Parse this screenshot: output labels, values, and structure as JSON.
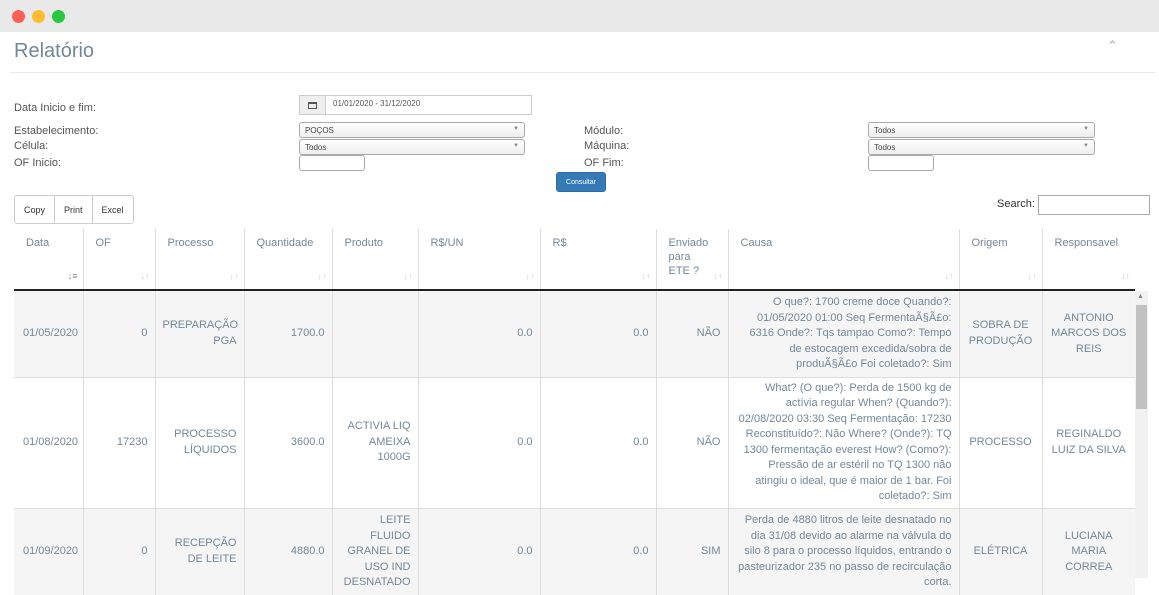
{
  "panel": {
    "title": "Relatório",
    "collapse_icon": "chevron-up-icon"
  },
  "filters": {
    "date_label": "Data Inicio e fim:",
    "date_value": "01/01/2020 - 31/12/2020",
    "estabelecimento_label": "Estabelecimento:",
    "estabelecimento_value": "POÇOS",
    "celula_label": "Célula:",
    "celula_value": "Todos",
    "of_inicio_label": "OF Inicio:",
    "modulo_label": "Módulo:",
    "modulo_value": "Todos",
    "maquina_label": "Máquina:",
    "maquina_value": "Todos",
    "of_fim_label": "OF Fim:",
    "consultar_label": "Consultar"
  },
  "toolbar": {
    "copy": "Copy",
    "print": "Print",
    "excel": "Excel",
    "search_label": "Search:"
  },
  "table": {
    "headers": [
      "Data",
      "OF",
      "Processo",
      "Quantidade",
      "Produto",
      "R$/UN",
      "R$",
      "Enviado para ETE ?",
      "Causa",
      "Origem",
      "Responsavel"
    ],
    "rows": [
      {
        "data": "01/05/2020",
        "of": "0",
        "processo": "PREPARAÇÃO PGA",
        "quantidade": "1700.0",
        "produto": "",
        "rsun": "0.0",
        "rs": "0.0",
        "ete": "NÃO",
        "causa": "O que?: 1700 creme doce Quando?: 01/05/2020 01:00 Seq FermentaÃ§Ã£o: 6316 Onde?: Tqs tampao Como?: Tempo de estocagem excedida/sobra de produÃ§Ã£o Foi coletado?: Sim",
        "origem": "SOBRA DE PRODUÇÃO",
        "responsavel": "ANTONIO MARCOS DOS REIS"
      },
      {
        "data": "01/08/2020",
        "of": "17230",
        "processo": "PROCESSO LÍQUIDOS",
        "quantidade": "3600.0",
        "produto": "ACTIVIA LIQ AMEIXA 1000G",
        "rsun": "0.0",
        "rs": "0.0",
        "ete": "NÃO",
        "causa": "What? (O que?): Perda de 1500 kg de actívia regular When? (Quando?): 02/08/2020 03:30 Seq Fermentação: 17230 Reconstituído?: Não Where? (Onde?): TQ 1300 fermentação everest How? (Como?): Pressão de ar estéril no TQ 1300 não atingiu o ideal, que é maior de 1 bar. Foi coletado?: Sim",
        "origem": "PROCESSO",
        "responsavel": "REGINALDO LUIZ DA SILVA"
      },
      {
        "data": "01/09/2020",
        "of": "0",
        "processo": "RECEPÇÃO DE LEITE",
        "quantidade": "4880.0",
        "produto": "LEITE FLUIDO GRANEL DE USO IND DESNATADO",
        "rsun": "0.0",
        "rs": "0.0",
        "ete": "SIM",
        "causa": "Perda de 4880 litros de leite desnatado no dia 31/08 devido ao alarme na válvula do silo 8 para o processo líquidos, entrando o pasteurizador 235 no passo de recirculação corta.",
        "origem": "ELÉTRICA",
        "responsavel": "LUCIANA MARIA CORREA"
      }
    ]
  }
}
